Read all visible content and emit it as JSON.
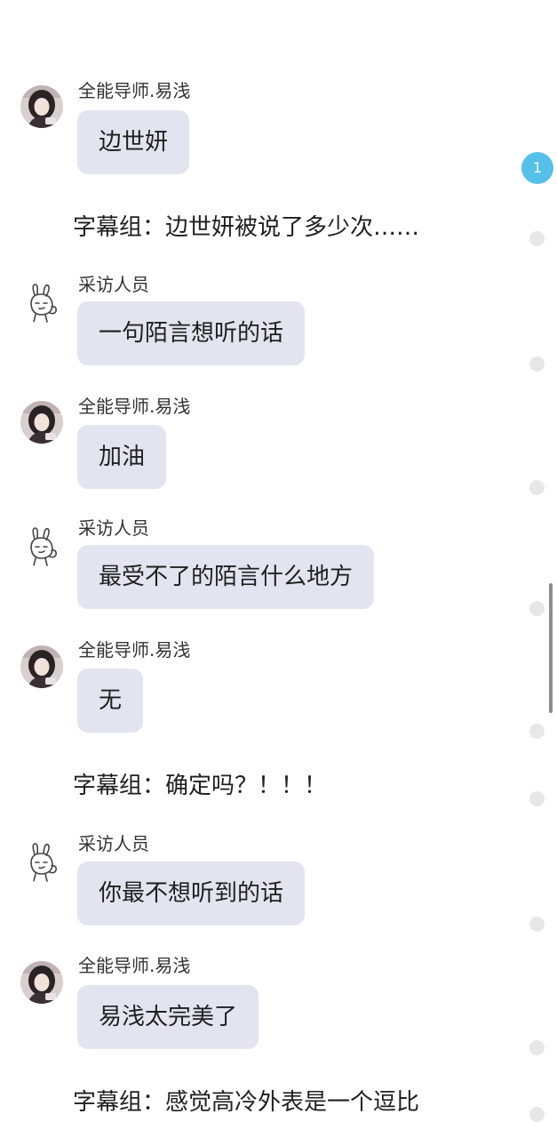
{
  "badge": {
    "count": "1"
  },
  "messages": [
    {
      "type": "bubble",
      "avatar": "photo-avatar",
      "sender": "全能导师.易浅",
      "text": "边世妍"
    },
    {
      "type": "caption",
      "text": "字幕组：边世妍被说了多少次……"
    },
    {
      "type": "bubble",
      "avatar": "bunny-avatar",
      "sender": "采访人员",
      "text": "一句陌言想听的话"
    },
    {
      "type": "bubble",
      "avatar": "photo-avatar",
      "sender": "全能导师.易浅",
      "text": "加油"
    },
    {
      "type": "bubble",
      "avatar": "bunny-avatar",
      "sender": "采访人员",
      "text": "最受不了的陌言什么地方"
    },
    {
      "type": "bubble",
      "avatar": "photo-avatar",
      "sender": "全能导师.易浅",
      "text": "无"
    },
    {
      "type": "caption",
      "text": "字幕组：确定吗？！！！"
    },
    {
      "type": "bubble",
      "avatar": "bunny-avatar",
      "sender": "采访人员",
      "text": "你最不想听到的话"
    },
    {
      "type": "bubble",
      "avatar": "photo-avatar",
      "sender": "全能导师.易浅",
      "text": "易浅太完美了"
    },
    {
      "type": "caption",
      "text": "字幕组：感觉高冷外表是一个逗比"
    }
  ]
}
